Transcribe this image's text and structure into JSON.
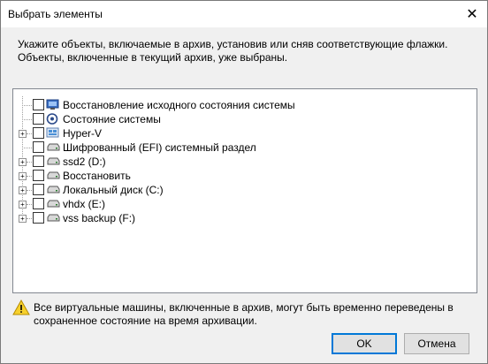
{
  "window": {
    "title": "Выбрать элементы"
  },
  "description": "Укажите объекты, включаемые в архив, установив или сняв соответствующие флажки. Объекты, включенные в текущий архив, уже выбраны.",
  "tree": {
    "items": [
      {
        "label": "Восстановление исходного состояния системы",
        "icon": "system-restore-icon",
        "expandable": false,
        "checked": false
      },
      {
        "label": "Состояние системы",
        "icon": "system-state-icon",
        "expandable": false,
        "checked": false
      },
      {
        "label": "Hyper-V",
        "icon": "hyper-v-icon",
        "expandable": true,
        "checked": false
      },
      {
        "label": "Шифрованный (EFI) системный раздел",
        "icon": "drive-icon",
        "expandable": false,
        "checked": false
      },
      {
        "label": "ssd2 (D:)",
        "icon": "drive-icon",
        "expandable": true,
        "checked": false
      },
      {
        "label": "Восстановить",
        "icon": "drive-icon",
        "expandable": true,
        "checked": false
      },
      {
        "label": "Локальный диск (C:)",
        "icon": "drive-icon",
        "expandable": true,
        "checked": false
      },
      {
        "label": "vhdx (E:)",
        "icon": "drive-icon",
        "expandable": true,
        "checked": false
      },
      {
        "label": "vss backup (F:)",
        "icon": "drive-icon",
        "expandable": true,
        "checked": false
      }
    ]
  },
  "warning": {
    "icon": "warning-icon",
    "text": "Все виртуальные машины, включенные в архив, могут быть временно переведены в сохраненное состояние на время архивации."
  },
  "buttons": {
    "ok": "OK",
    "cancel": "Отмена"
  }
}
